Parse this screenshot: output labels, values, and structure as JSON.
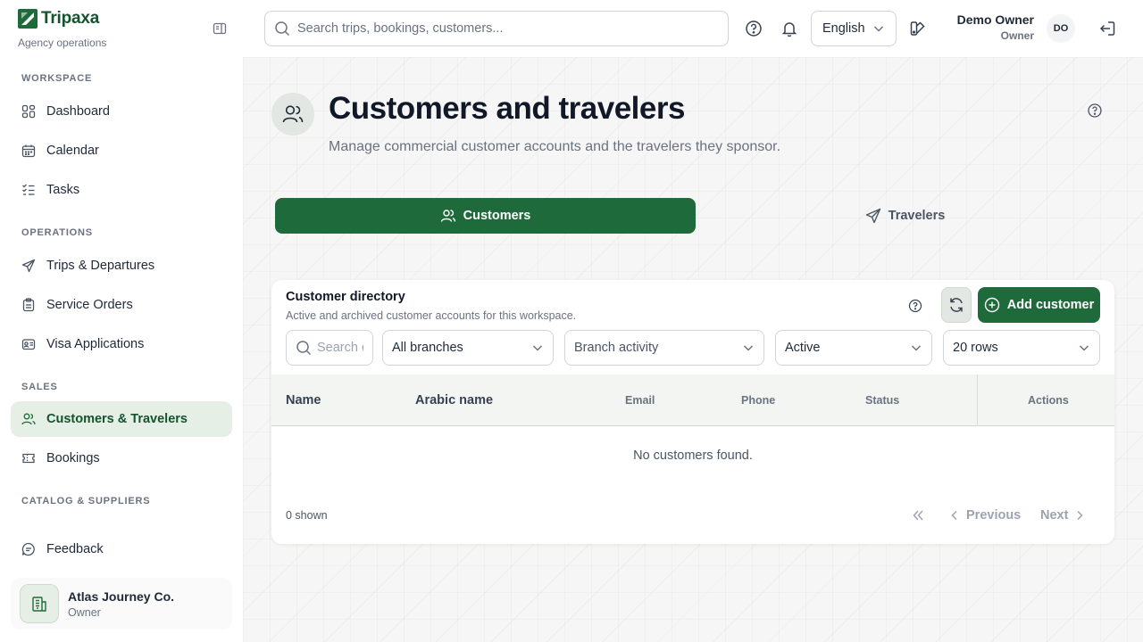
{
  "brand": {
    "name": "Tripaxa",
    "subtitle": "Agency operations"
  },
  "topbar": {
    "search_placeholder": "Search trips, bookings, customers...",
    "language": "English",
    "user_name": "Demo Owner",
    "user_role": "Owner",
    "avatar_initials": "DO"
  },
  "sidebar": {
    "sections": [
      {
        "label": "Workspace"
      },
      {
        "label": "Operations"
      },
      {
        "label": "Sales"
      },
      {
        "label": "Catalog & Suppliers"
      }
    ],
    "items": [
      {
        "label": "Dashboard",
        "icon": "dashboard-icon"
      },
      {
        "label": "Calendar",
        "icon": "calendar-icon"
      },
      {
        "label": "Tasks",
        "icon": "tasks-icon"
      },
      {
        "label": "Trips & Departures",
        "icon": "send-icon"
      },
      {
        "label": "Service Orders",
        "icon": "clipboard-icon"
      },
      {
        "label": "Visa Applications",
        "icon": "id-card-icon"
      },
      {
        "label": "Customers & Travelers",
        "icon": "users-icon",
        "active": true
      },
      {
        "label": "Bookings",
        "icon": "ticket-icon"
      },
      {
        "label": "Feedback",
        "icon": "message-icon"
      }
    ],
    "org": {
      "name": "Atlas Journey Co.",
      "role": "Owner"
    }
  },
  "page": {
    "title": "Customers and travelers",
    "subtitle": "Manage commercial customer accounts and the travelers they sponsor."
  },
  "tabs": [
    {
      "label": "Customers",
      "active": true
    },
    {
      "label": "Travelers",
      "active": false
    }
  ],
  "directory": {
    "title": "Customer directory",
    "subtitle": "Active and archived customer accounts for this workspace.",
    "add_label": "Add customer",
    "search_placeholder": "Search customers",
    "filters": {
      "branch": "All branches",
      "branch_activity": "Branch activity",
      "status": "Active",
      "rows": "20 rows"
    },
    "columns": [
      "Name",
      "Arabic name",
      "Email",
      "Phone",
      "Status",
      "Actions"
    ],
    "empty_message": "No customers found.",
    "shown": "0 shown",
    "pager": {
      "previous": "Previous",
      "next": "Next"
    }
  },
  "colors": {
    "primary": "#1f6a3a",
    "active_bg": "#e6efe6",
    "background": "#f5f6f5"
  }
}
